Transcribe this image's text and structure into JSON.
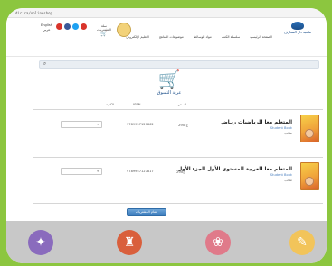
{
  "url": "dir.ca/onlineshop",
  "header": {
    "logo_text": "مكتبة دار المعارف",
    "nav": [
      "الصفحة الرئيسية",
      "سلسلة الكتب",
      "مواد الوسائط",
      "موضوعات المناهج",
      "التعليم الإلكتروني"
    ],
    "cart_mini": {
      "label": "سلة",
      "sub": "المشتريات"
    },
    "language": {
      "en": "English",
      "ar": "عربي"
    },
    "social": [
      {
        "icon": "youtube-icon",
        "color": "#d9342b",
        "glyph": "▶"
      },
      {
        "icon": "facebook-icon",
        "color": "#3b5998",
        "glyph": "f"
      },
      {
        "icon": "twitter-icon",
        "color": "#1da1f2",
        "glyph": "t"
      },
      {
        "icon": "google-icon",
        "color": "#d9342b",
        "glyph": "g"
      }
    ]
  },
  "search": {
    "placeholder": ""
  },
  "cart": {
    "title": "عربة التسوق"
  },
  "columns": {
    "price": "السعر",
    "isbn": "ISBN",
    "quantity": "الكمية"
  },
  "items": [
    {
      "title": "المتعلم معا للرياضيات ريـاض",
      "subtitle": "Student Book",
      "type": "طالب",
      "price": "290 ج",
      "isbn": "9789957127862",
      "qty": ""
    },
    {
      "title": "المتعلم معا للعربية المستوى الأول الجزء الأول",
      "subtitle": "Student Book",
      "type": "طالب",
      "price": "290ج",
      "isbn": "9789957127817",
      "qty": ""
    }
  ],
  "action_button": "إتمام المشتريات",
  "footer": {
    "icons": [
      {
        "name": "telescope-icon",
        "color": "#8a6bbd",
        "glyph": "✦"
      },
      {
        "name": "tower-icon",
        "color": "#d95f3c",
        "glyph": "♜"
      },
      {
        "name": "flower-icon",
        "color": "#e07a8a",
        "glyph": "❀"
      },
      {
        "name": "book-icon",
        "color": "#f2c45a",
        "glyph": "✎"
      }
    ]
  }
}
